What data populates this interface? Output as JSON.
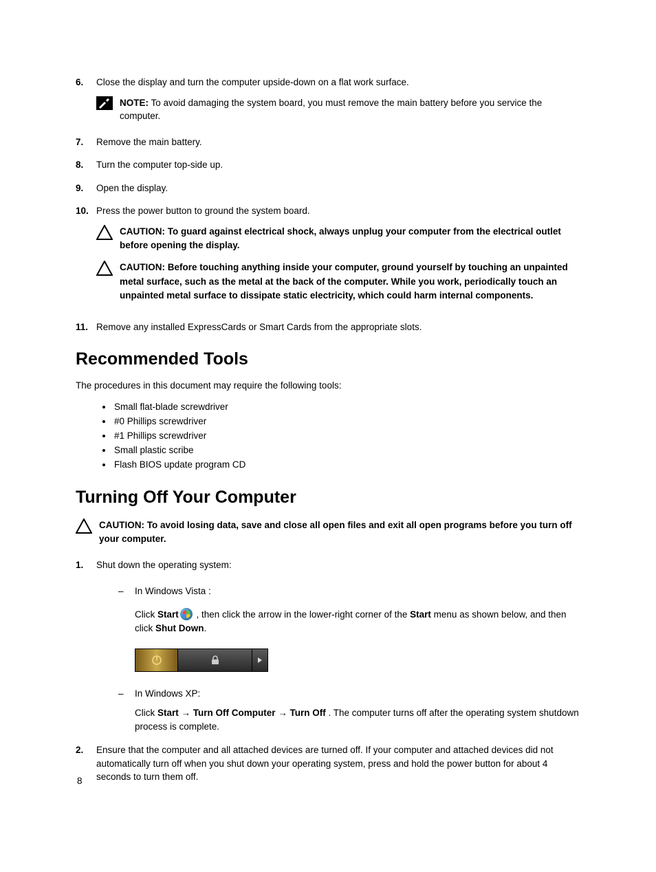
{
  "steps_a": {
    "s6": {
      "num": "6.",
      "text": "Close the display and turn the computer upside-down on a flat work surface."
    },
    "note1": {
      "label": "NOTE:",
      "text": " To avoid damaging the system board, you must remove the main battery before you service the computer."
    },
    "s7": {
      "num": "7.",
      "text": "Remove the main battery."
    },
    "s8": {
      "num": "8.",
      "text": "Turn the computer top-side up."
    },
    "s9": {
      "num": "9.",
      "text": "Open the display."
    },
    "s10": {
      "num": "10.",
      "text": "Press the power button to ground the system board."
    },
    "caution1": "CAUTION: To guard against electrical shock, always unplug your computer from the electrical outlet before opening the display.",
    "caution2": "CAUTION: Before touching anything inside your computer, ground yourself by touching an unpainted metal surface, such as the metal at the back of the computer. While you work, periodically touch an unpainted metal surface to dissipate static electricity, which could harm internal components.",
    "s11": {
      "num": "11.",
      "text": "Remove any installed ExpressCards or Smart Cards from the appropriate slots."
    }
  },
  "tools": {
    "heading": "Recommended Tools",
    "intro": "The procedures in this document may require the following tools:",
    "items": [
      "Small flat-blade screwdriver",
      "#0 Phillips screwdriver",
      "#1 Phillips screwdriver",
      "Small plastic scribe",
      "Flash BIOS update program CD"
    ]
  },
  "turnoff": {
    "heading": "Turning Off Your Computer",
    "caution": "CAUTION: To avoid losing data, save and close all open files and exit all open programs before you turn off your computer.",
    "s1": {
      "num": "1.",
      "text": "Shut down the operating system:"
    },
    "vista_label": "In Windows Vista :",
    "vista_p1a": "Click ",
    "vista_start": "Start",
    "vista_p1b": " , then click the arrow in the lower-right corner of the ",
    "vista_startmenu": "Start",
    "vista_p1c": " menu as shown below, and then click ",
    "vista_shutdown": "Shut Down",
    "vista_p1d": ".",
    "xp_label": "In Windows XP:",
    "xp_p1a": "Click ",
    "xp_start": "Start",
    "xp_arrow1": " → ",
    "xp_turnoffcomp": "Turn Off Computer",
    "xp_arrow2": " → ",
    "xp_turnoff": "Turn Off",
    "xp_p1b": " . The computer turns off after the operating system shutdown process is complete.",
    "s2": {
      "num": "2.",
      "text": "Ensure that the computer and all attached devices are turned off. If your computer and attached devices did not automatically turn off when you shut down your operating system, press and hold the power button for about 4 seconds to turn them off."
    }
  },
  "page_number": "8"
}
